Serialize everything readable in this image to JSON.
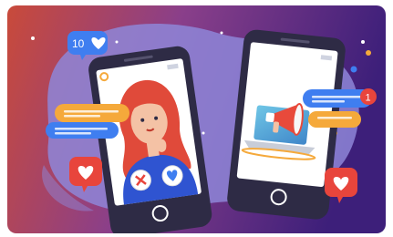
{
  "illustration": {
    "notification_count": "10",
    "badge_count": "1",
    "colors": {
      "bg_left": "#c94a3a",
      "bg_mid": "#7b3f8e",
      "bg_right": "#3d1f7a",
      "blob": "#8e86d8",
      "phone_body": "#2e2b45",
      "screen": "#ffffff",
      "heart_red": "#e8453c",
      "bubble_blue": "#3f7ef0",
      "bubble_orange": "#f5a93b",
      "hair": "#e04a3a",
      "shirt": "#2f54d1",
      "skin": "#f4c2a5",
      "screen_teal": "#5fb8d9",
      "megaphone": "#e84a3b"
    },
    "icons": [
      "heart-icon",
      "like-notification-icon",
      "reject-x-icon",
      "like-heart-icon",
      "megaphone-icon",
      "home-button-icon"
    ]
  }
}
